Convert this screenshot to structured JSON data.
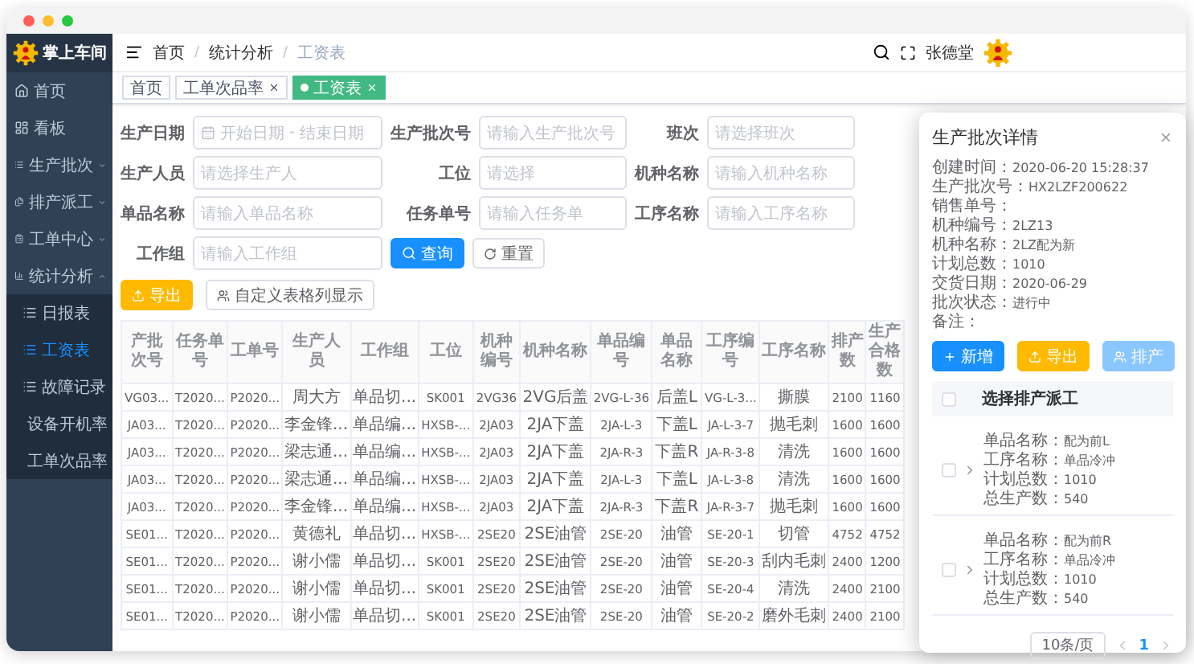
{
  "sidebar": {
    "logo_text": "掌上车间",
    "items": [
      {
        "label": "首页",
        "selected": false
      },
      {
        "label": "看板",
        "selected": false
      },
      {
        "label": "生产批次",
        "selected": false,
        "expanded": false
      },
      {
        "label": "排产派工",
        "selected": false,
        "expanded": false
      },
      {
        "label": "工单中心",
        "selected": false,
        "expanded": false
      },
      {
        "label": "统计分析",
        "selected": false,
        "expanded": true,
        "children": [
          {
            "label": "日报表",
            "selected": false
          },
          {
            "label": "工资表",
            "selected": true
          },
          {
            "label": "故障记录",
            "selected": false
          },
          {
            "label": "设备开机率",
            "selected": false
          },
          {
            "label": "工单次品率",
            "selected": false
          }
        ]
      }
    ]
  },
  "header": {
    "breadcrumb": [
      "首页",
      "统计分析",
      "工资表"
    ],
    "breadcrumb_separator": "/",
    "user": "张德堂"
  },
  "tags": [
    {
      "label": "首页",
      "selected": false,
      "closable": false
    },
    {
      "label": "工单次品率",
      "selected": false,
      "closable": true
    },
    {
      "label": "工资表",
      "selected": true,
      "closable": true
    }
  ],
  "filters": [
    {
      "label": "生产日期",
      "kind": "date",
      "start_placeholder": "开始日期",
      "separator": "-",
      "end_placeholder": "结束日期"
    },
    {
      "label": "生产批次号",
      "kind": "text",
      "placeholder": "请输入生产批次号"
    },
    {
      "label": "班次",
      "kind": "text",
      "placeholder": "请选择班次"
    },
    {
      "label": "生产人员",
      "kind": "text",
      "placeholder": "请选择生产人"
    },
    {
      "label": "工位",
      "kind": "text",
      "placeholder": "请选择"
    },
    {
      "label": "机种名称",
      "kind": "text",
      "placeholder": "请输入机种名称"
    },
    {
      "label": "单品名称",
      "kind": "text",
      "placeholder": "请输入单品名称"
    },
    {
      "label": "任务单号",
      "kind": "text",
      "placeholder": "请输入任务单"
    },
    {
      "label": "工序名称",
      "kind": "text",
      "placeholder": "请输入工序名称"
    },
    {
      "label": "工作组",
      "kind": "text",
      "placeholder": "请输入工作组"
    }
  ],
  "search_button": "查询",
  "reset_button": "重置",
  "actions": [
    {
      "label": "导出",
      "kind": "export"
    },
    {
      "label": "自定义表格列显示",
      "kind": "columns"
    }
  ],
  "table": {
    "columns": [
      "产批次号",
      "任务单号",
      "工单号",
      "生产人员",
      "工作组",
      "工位",
      "机种编号",
      "机种名称",
      "单品编号",
      "单品名称",
      "工序编号",
      "工序名称",
      "排产数",
      "生产合格数"
    ],
    "rows": [
      [
        "VG03...",
        "T2020...",
        "P2020...",
        "周大方",
        "单品切...",
        "SK001",
        "2VG36",
        "2VG后盖",
        "2VG-L-36",
        "后盖L",
        "VG-L-3...",
        "撕膜",
        "2100",
        "1160"
      ],
      [
        "JA03...",
        "T2020...",
        "P2020...",
        "李金锋...",
        "单品编...",
        "HXSB-...",
        "2JA03",
        "2JA下盖",
        "2JA-L-3",
        "下盖L",
        "JA-L-3-7",
        "抛毛刺",
        "1600",
        "1600"
      ],
      [
        "JA03...",
        "T2020...",
        "P2020...",
        "梁志通...",
        "单品编...",
        "HXSB-...",
        "2JA03",
        "2JA下盖",
        "2JA-R-3",
        "下盖R",
        "JA-R-3-8",
        "清洗",
        "1600",
        "1600"
      ],
      [
        "JA03...",
        "T2020...",
        "P2020...",
        "梁志通...",
        "单品编...",
        "HXSB-...",
        "2JA03",
        "2JA下盖",
        "2JA-L-3",
        "下盖L",
        "JA-L-3-8",
        "清洗",
        "1600",
        "1600"
      ],
      [
        "JA03...",
        "T2020...",
        "P2020...",
        "李金锋...",
        "单品编...",
        "HXSB-...",
        "2JA03",
        "2JA下盖",
        "2JA-R-3",
        "下盖R",
        "JA-R-3-7",
        "抛毛刺",
        "1600",
        "1600"
      ],
      [
        "SE01...",
        "T2020...",
        "P2020...",
        "黄德礼",
        "单品切...",
        "HXSB-...",
        "2SE20",
        "2SE油管",
        "2SE-20",
        "油管",
        "SE-20-1",
        "切管",
        "4752",
        "4752"
      ],
      [
        "SE01...",
        "T2020...",
        "P2020...",
        "谢小儒",
        "单品切...",
        "SK001",
        "2SE20",
        "2SE油管",
        "2SE-20",
        "油管",
        "SE-20-3",
        "刮内毛刺",
        "2400",
        "1200"
      ],
      [
        "SE01...",
        "T2020...",
        "P2020...",
        "谢小儒",
        "单品切...",
        "SK001",
        "2SE20",
        "2SE油管",
        "2SE-20",
        "油管",
        "SE-20-4",
        "清洗",
        "2400",
        "2100"
      ],
      [
        "SE01...",
        "T2020...",
        "P2020...",
        "谢小儒",
        "单品切...",
        "SK001",
        "2SE20",
        "2SE油管",
        "2SE-20",
        "油管",
        "SE-20-2",
        "磨外毛刺",
        "2400",
        "2100"
      ]
    ]
  },
  "dialog": {
    "title": "生产批次详情",
    "created": {
      "label": "创建时间：",
      "value": "2020-06-20 15:28:37"
    },
    "fields": [
      {
        "label": "生产批次号：",
        "value": "HX2LZF200622"
      },
      {
        "label": "销售单号："
      },
      {
        "label": "机种编号：",
        "value": "2LZ13"
      },
      {
        "label": "机种名称：",
        "value": "2LZ配为新"
      },
      {
        "label": "计划总数：",
        "value": "1010"
      },
      {
        "label": "交货日期：",
        "value": "2020-06-29"
      },
      {
        "label": "批次状态：",
        "value": "进行中"
      },
      {
        "label": "备注："
      }
    ],
    "buttons": [
      {
        "label": "新增",
        "kind": "add",
        "disabled": false
      },
      {
        "label": "导出",
        "kind": "export",
        "disabled": false
      },
      {
        "label": "排产",
        "kind": "schedule",
        "disabled": true
      }
    ],
    "list_header": "选择排产派工",
    "list_header_checked": false,
    "items": [
      {
        "checked": false,
        "expanded": false,
        "fields": [
          {
            "label": "单品名称：",
            "value": "配为前L"
          },
          {
            "label": "工序名称：",
            "value": "单品冷冲"
          },
          {
            "label": "计划总数：",
            "value": "1010"
          },
          {
            "label": "总生产数：",
            "value": "540"
          }
        ]
      },
      {
        "checked": false,
        "expanded": false,
        "fields": [
          {
            "label": "单品名称：",
            "value": "配为前R"
          },
          {
            "label": "工序名称：",
            "value": "单品冷冲"
          },
          {
            "label": "计划总数：",
            "value": "1010"
          },
          {
            "label": "总生产数：",
            "value": "540"
          }
        ]
      }
    ],
    "page_size": "10条/页",
    "pages": [
      {
        "label": "1",
        "selected": true
      }
    ]
  }
}
